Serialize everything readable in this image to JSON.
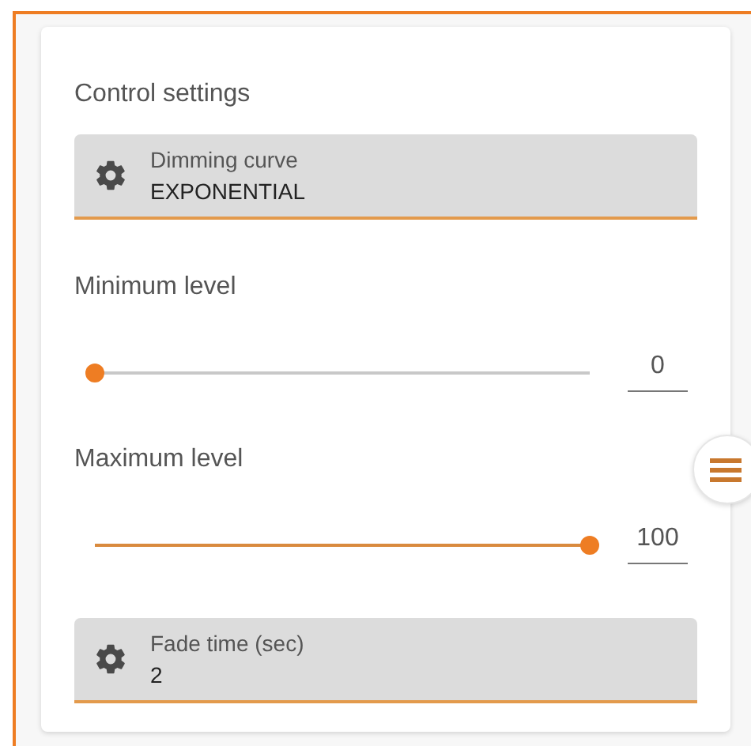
{
  "section_title": "Control settings",
  "dimming_curve": {
    "label": "Dimming curve",
    "value": "EXPONENTIAL"
  },
  "sliders": [
    {
      "label": "Minimum level",
      "level": 0,
      "reading": "0"
    },
    {
      "label": "Maximum level",
      "level": 1,
      "reading": "100"
    }
  ],
  "fade_time": {
    "label": "Fade time (sec)",
    "value": "2"
  }
}
